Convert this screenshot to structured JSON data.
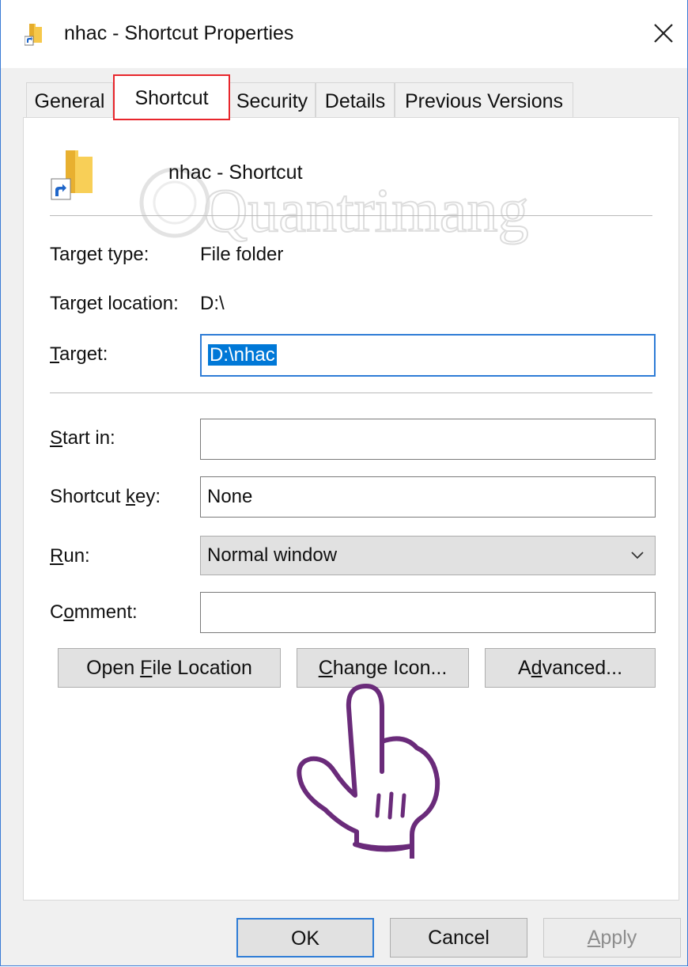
{
  "window": {
    "title": "nhac - Shortcut Properties",
    "close_icon": "close-icon",
    "title_icon": "folder-shortcut-icon"
  },
  "tabs": [
    {
      "label": "General"
    },
    {
      "label": "Shortcut",
      "active": true
    },
    {
      "label": "Security"
    },
    {
      "label": "Details"
    },
    {
      "label": "Previous Versions"
    }
  ],
  "header": {
    "name": "nhac - Shortcut",
    "icon": "folder-shortcut-icon"
  },
  "watermark": {
    "text": "Quantrimang"
  },
  "fields": {
    "target_type_label": "Target type:",
    "target_type_value": "File folder",
    "target_location_label": "Target location:",
    "target_location_value": "D:\\",
    "target_label_u": "T",
    "target_label_rest": "arget:",
    "target_value": "D:\\nhac",
    "start_in_label_u": "S",
    "start_in_label_rest": "tart in:",
    "start_in_value": "",
    "shortcut_key_label_a": "Shortcut ",
    "shortcut_key_label_u": "k",
    "shortcut_key_label_b": "ey:",
    "shortcut_key_value": "None",
    "run_label_u": "R",
    "run_label_rest": "un:",
    "run_value": "Normal window",
    "comment_label_a": "C",
    "comment_label_u": "o",
    "comment_label_b": "mment:",
    "comment_value": ""
  },
  "buttons": {
    "open_file_location_a": "Open ",
    "open_file_location_u": "F",
    "open_file_location_b": "ile Location",
    "change_icon_u": "C",
    "change_icon_rest": "hange Icon...",
    "advanced_a": "A",
    "advanced_u": "d",
    "advanced_b": "vanced...",
    "ok": "OK",
    "cancel": "Cancel",
    "apply_u": "A",
    "apply_rest": "pply"
  },
  "colors": {
    "highlight": "#e8262c",
    "selection": "#0078d7",
    "focus_border": "#2e7cd6",
    "hand_outline": "#6a2b7a"
  }
}
